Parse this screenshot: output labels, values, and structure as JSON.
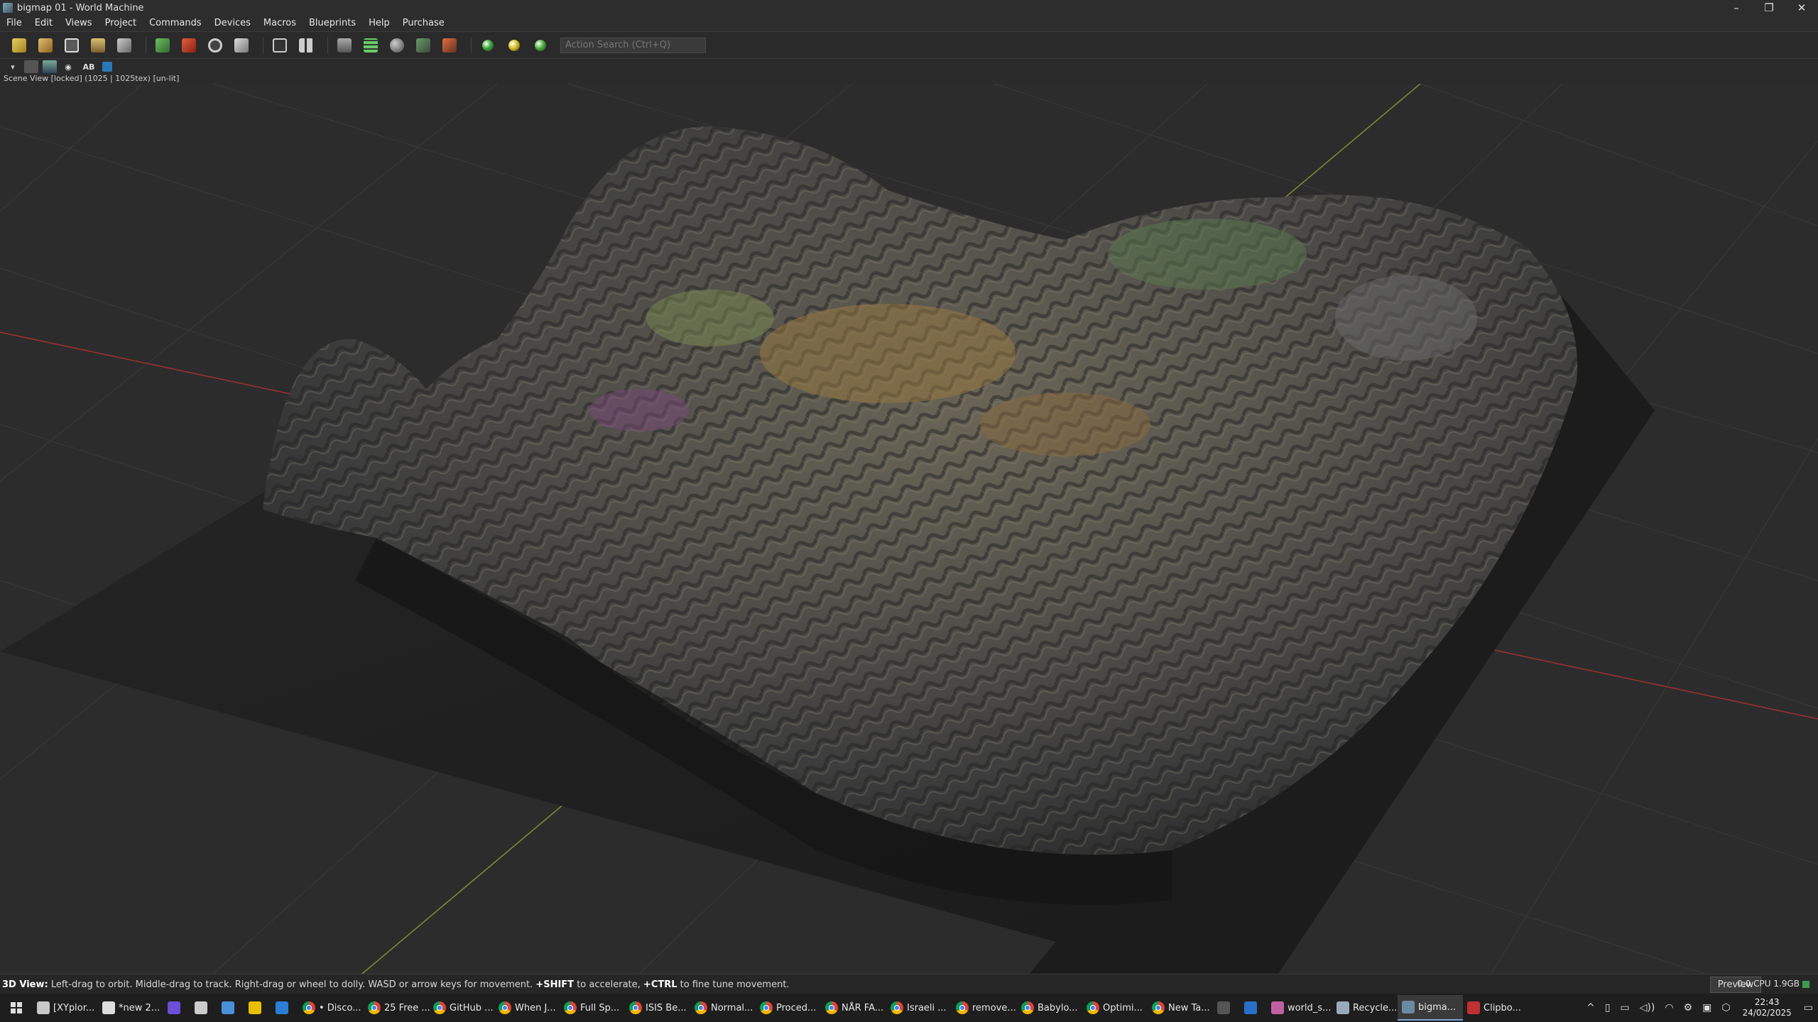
{
  "window": {
    "title": "bigmap 01 - World Machine",
    "minimize": "–",
    "restore": "❐",
    "close": "✕"
  },
  "menu": [
    "File",
    "Edit",
    "Views",
    "Project",
    "Commands",
    "Devices",
    "Macros",
    "Blueprints",
    "Help",
    "Purchase"
  ],
  "toolbar": {
    "search_placeholder": "Action Search (Ctrl+Q)",
    "buttons": [
      "new-icon",
      "open-icon",
      "help-icon",
      "save-icon",
      "scissor-icon",
      "chart-icon",
      "report-icon",
      "target-icon",
      "build-icon",
      "panel-icon",
      "layout-grid-icon",
      "output-icon",
      "grid-icon",
      "sphere-icon",
      "view-icon",
      "paint-icon"
    ],
    "status_dots": [
      "#3aa83a",
      "#d4c020",
      "#4cae3a"
    ]
  },
  "viewbar": {
    "ab_label": "AB",
    "scene_label": "Scene View [locked] (1025 | 1025tex) [un-lit]"
  },
  "status": {
    "hint_prefix": "3D View:",
    "hint_a": " Left-drag to orbit. Middle-drag to track. Right-drag or wheel to dolly. WASD or arrow keys for movement. ",
    "shift_key": "+SHIFT",
    "hint_b": " to accelerate, ",
    "ctrl_key": "+CTRL",
    "hint_c": " to fine tune movement.",
    "preview_label": "Preview",
    "cpu_text": "0.0 CPU 1.9GB"
  },
  "taskbar": {
    "items": [
      {
        "label": "[XYplor...",
        "kind": "app",
        "color": "#c8c8c8"
      },
      {
        "label": "*new 2...",
        "kind": "app",
        "color": "#ddd"
      },
      {
        "label": "",
        "kind": "app",
        "color": "#6b4fd8"
      },
      {
        "label": "",
        "kind": "app",
        "color": "#ccc"
      },
      {
        "label": "",
        "kind": "app",
        "color": "#4a90d9"
      },
      {
        "label": "",
        "kind": "app",
        "color": "#e8c000"
      },
      {
        "label": "",
        "kind": "app",
        "color": "#2a7fd4"
      },
      {
        "label": "• Disco...",
        "kind": "chrome"
      },
      {
        "label": "25 Free ...",
        "kind": "chrome"
      },
      {
        "label": "GitHub ...",
        "kind": "chrome"
      },
      {
        "label": "When J...",
        "kind": "chrome"
      },
      {
        "label": "Full Sp...",
        "kind": "chrome"
      },
      {
        "label": "ISIS Be...",
        "kind": "chrome"
      },
      {
        "label": "Normal...",
        "kind": "chrome"
      },
      {
        "label": "Proced...",
        "kind": "chrome"
      },
      {
        "label": "NÅR FA...",
        "kind": "chrome"
      },
      {
        "label": "Israeli ...",
        "kind": "chrome"
      },
      {
        "label": "remove...",
        "kind": "chrome"
      },
      {
        "label": "Babylo...",
        "kind": "chrome"
      },
      {
        "label": "Optimi...",
        "kind": "chrome"
      },
      {
        "label": "New Ta...",
        "kind": "chrome"
      },
      {
        "label": "",
        "kind": "app",
        "color": "#555"
      },
      {
        "label": "",
        "kind": "app",
        "color": "#2a6fc9"
      },
      {
        "label": "world_s...",
        "kind": "app",
        "color": "#c060a0"
      },
      {
        "label": "Recycle...",
        "kind": "app",
        "color": "#9ab"
      },
      {
        "label": "bigma...",
        "kind": "app",
        "color": "#6a8aa0",
        "active": true
      },
      {
        "label": "Clipbo...",
        "kind": "app",
        "color": "#c03030"
      }
    ],
    "tray": [
      "^",
      "▯",
      "▭",
      "◁))",
      "◠",
      "⚙",
      "▣",
      "⬡"
    ],
    "time": "22:43",
    "date": "24/02/2025"
  }
}
